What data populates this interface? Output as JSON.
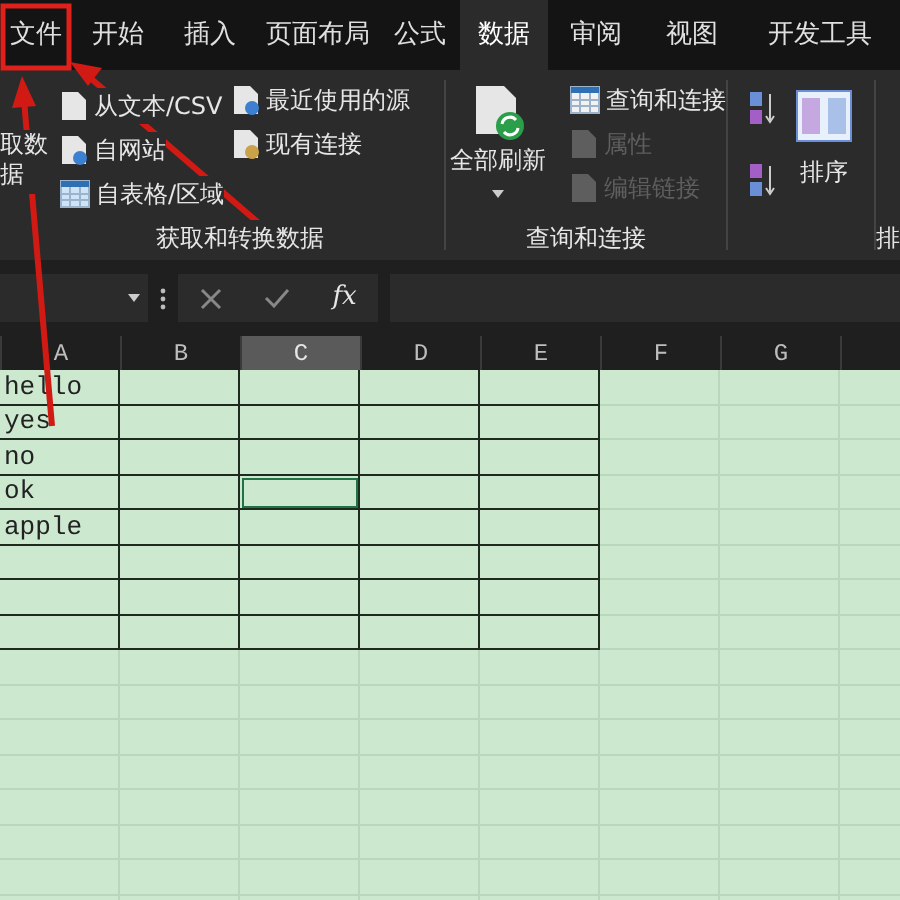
{
  "tabs": [
    {
      "label": "文件",
      "selected": false
    },
    {
      "label": "开始",
      "selected": false
    },
    {
      "label": "插入",
      "selected": false
    },
    {
      "label": "页面布局",
      "selected": false
    },
    {
      "label": "公式",
      "selected": false
    },
    {
      "label": "数据",
      "selected": true
    },
    {
      "label": "审阅",
      "selected": false
    },
    {
      "label": "视图",
      "selected": false
    },
    {
      "label": "开发工具",
      "selected": false
    }
  ],
  "ribbon": {
    "get_data": {
      "button_lines": [
        "取数",
        "据"
      ],
      "column_1": [
        {
          "label": "从文本/CSV"
        },
        {
          "label": "自网站"
        },
        {
          "label": "自表格/区域"
        }
      ],
      "column_2": [
        {
          "label": "最近使用的源"
        },
        {
          "label": "现有连接"
        }
      ],
      "group_label": "获取和转换数据"
    },
    "queries": {
      "refresh_label": "全部刷新",
      "items": [
        {
          "label": "查询和连接",
          "disabled": false
        },
        {
          "label": "属性",
          "disabled": true
        },
        {
          "label": "编辑链接",
          "disabled": true
        }
      ],
      "group_label": "查询和连接"
    },
    "sort": {
      "sort_label": "排序",
      "group_label": "排"
    }
  },
  "formula_bar": {
    "fx": "fx"
  },
  "sheet": {
    "columns": [
      {
        "label": "A",
        "selected": false
      },
      {
        "label": "B",
        "selected": false
      },
      {
        "label": "C",
        "selected": true
      },
      {
        "label": "D",
        "selected": false
      },
      {
        "label": "E",
        "selected": false
      },
      {
        "label": "F",
        "selected": false
      },
      {
        "label": "G",
        "selected": false
      },
      {
        "selected": false
      }
    ],
    "rows": [
      {
        "cells": [
          {
            "text": "hello",
            "selected": false
          },
          {
            "selected": false
          },
          {
            "selected": false
          },
          {
            "selected": false
          },
          {
            "selected": false
          }
        ]
      },
      {
        "cells": [
          {
            "text": "yes",
            "selected": false
          },
          {
            "selected": false
          },
          {
            "selected": false
          },
          {
            "selected": false
          },
          {
            "selected": false
          }
        ]
      },
      {
        "cells": [
          {
            "text": "no",
            "selected": false
          },
          {
            "selected": false
          },
          {
            "selected": false
          },
          {
            "selected": false
          },
          {
            "selected": false
          }
        ]
      },
      {
        "cells": [
          {
            "text": "ok",
            "selected": false
          },
          {
            "selected": false
          },
          {
            "selected": true
          },
          {
            "selected": false
          },
          {
            "selected": false
          }
        ]
      },
      {
        "cells": [
          {
            "text": "apple",
            "selected": false
          },
          {
            "selected": false
          },
          {
            "selected": false
          },
          {
            "selected": false
          },
          {
            "selected": false
          }
        ]
      },
      {
        "cells": [
          {
            "selected": false
          },
          {
            "selected": false
          },
          {
            "selected": false
          },
          {
            "selected": false
          },
          {
            "selected": false
          }
        ]
      },
      {
        "cells": [
          {
            "selected": false
          },
          {
            "selected": false
          },
          {
            "selected": false
          },
          {
            "selected": false
          },
          {
            "selected": false
          }
        ]
      },
      {
        "cells": [
          {
            "selected": false
          },
          {
            "selected": false
          },
          {
            "selected": false
          },
          {
            "selected": false
          },
          {
            "selected": false
          }
        ]
      }
    ]
  }
}
